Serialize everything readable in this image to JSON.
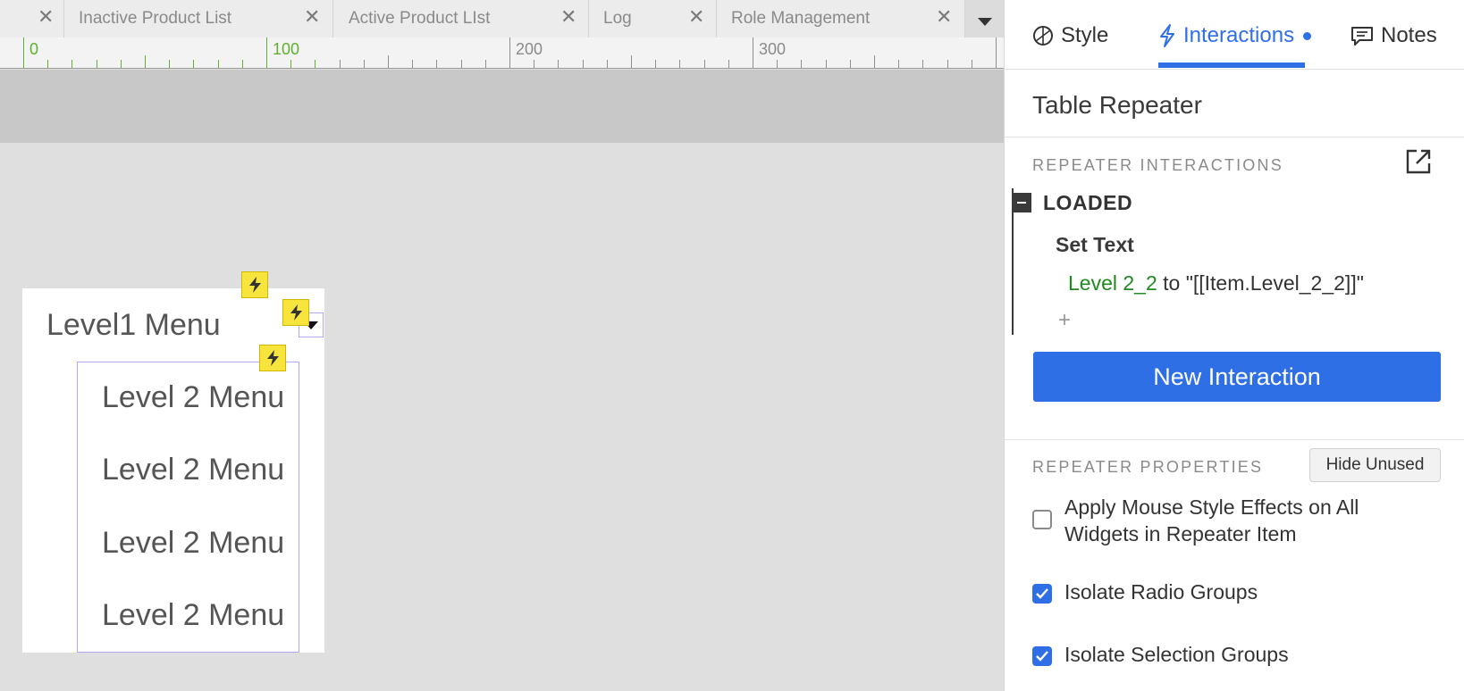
{
  "tabs": [
    {
      "label": "",
      "close": "✕"
    },
    {
      "label": "Inactive Product List",
      "close": "✕"
    },
    {
      "label": "Active Product LIst",
      "close": "✕"
    },
    {
      "label": "Log",
      "close": "✕"
    },
    {
      "label": "Role Management",
      "close": "✕"
    }
  ],
  "ruler": {
    "labels": [
      "0",
      "100",
      "200",
      "300"
    ]
  },
  "canvas": {
    "level1_label": "Level1 Menu",
    "repeater_rows": [
      "Level 2 Menu",
      "Level 2 Menu",
      "Level 2 Menu",
      "Level 2 Menu"
    ]
  },
  "inspector": {
    "tabs": {
      "style": "Style",
      "interactions": "Interactions",
      "notes": "Notes"
    },
    "widget_title": "Table Repeater",
    "interactions_section": "REPEATER INTERACTIONS",
    "event": "LOADED",
    "action": "Set Text",
    "action_target": "Level 2_2",
    "action_rest": " to \"[[Item.Level_2_2]]\"",
    "add_symbol": "+",
    "new_interaction": "New Interaction",
    "properties_section": "REPEATER PROPERTIES",
    "hide_unused": "Hide Unused",
    "properties": [
      {
        "label_line1": "Apply Mouse Style Effects on All",
        "label_line2": "Widgets in Repeater Item",
        "checked": false
      },
      {
        "label_line1": "Isolate Radio Groups",
        "checked": true
      },
      {
        "label_line1": "Isolate Selection Groups",
        "checked": true
      }
    ]
  },
  "colors": {
    "accent": "#2f6fe6",
    "badge": "#f7e43c",
    "selection": "#b9a6f0",
    "target_green": "#1f8a1f",
    "ruler_green": "#5fb02e"
  },
  "icons": [
    "close-icon",
    "chevron-down-icon",
    "style-icon",
    "lightning-icon",
    "notes-icon",
    "popout-icon",
    "collapse-icon",
    "checkbox-icon"
  ]
}
